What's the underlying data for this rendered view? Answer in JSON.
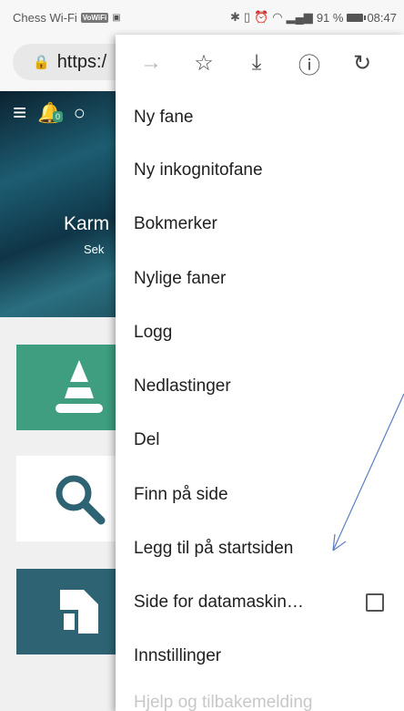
{
  "status": {
    "carrier": "Chess Wi-Fi",
    "vowifi": "VoWiFi",
    "sim_icon": "sim-icon",
    "signal_icons": "bluetooth vibrate alarm wifi signal",
    "battery_percent": "91 %",
    "time": "08:47"
  },
  "url_bar": {
    "scheme": "https:/",
    "lock_icon": "lock-icon"
  },
  "page": {
    "hero_title": "Karm",
    "hero_subtitle": "Sek",
    "notification_count": "0"
  },
  "menu": {
    "toolbar": [
      {
        "icon": "forward-arrow-icon",
        "glyph": "→",
        "enabled": false
      },
      {
        "icon": "star-bookmark-icon",
        "glyph": "☆",
        "enabled": true
      },
      {
        "icon": "download-icon",
        "glyph": "⤓",
        "enabled": true
      },
      {
        "icon": "info-icon",
        "glyph": "ⓘ",
        "enabled": true
      },
      {
        "icon": "refresh-icon",
        "glyph": "↻",
        "enabled": true
      }
    ],
    "items": [
      {
        "label": "Ny fane"
      },
      {
        "label": "Ny inkognitofane"
      },
      {
        "label": "Bokmerker"
      },
      {
        "label": "Nylige faner"
      },
      {
        "label": "Logg"
      },
      {
        "label": "Nedlastinger"
      },
      {
        "label": "Del"
      },
      {
        "label": "Finn på side"
      },
      {
        "label": "Legg til på startsiden"
      },
      {
        "label": "Side for datamaskin…",
        "checked": false
      },
      {
        "label": "Innstillinger"
      },
      {
        "label": "Hjelp og tilbakemelding"
      }
    ]
  },
  "colors": {
    "accent_green": "#3e9e7f",
    "card_teal": "#2d6373",
    "annotation_arrow": "#5a7fc0"
  }
}
